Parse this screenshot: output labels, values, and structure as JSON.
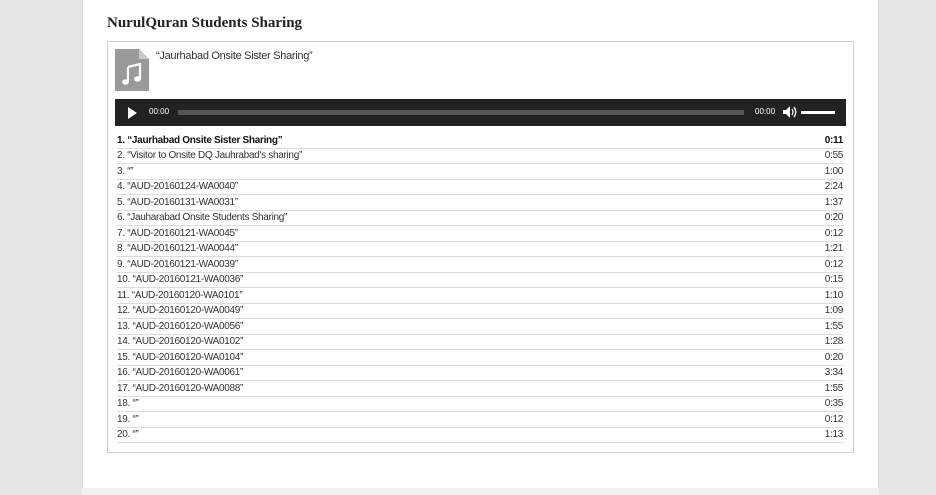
{
  "page": {
    "title": "NurulQuran Students Sharing"
  },
  "player": {
    "current_title": "“Jaurhabad Onsite Sister Sharing”",
    "current_time": "00:00",
    "total_time": "00:00",
    "progress": 0,
    "volume": 1.0,
    "icons": {
      "file": "audio-file-icon",
      "play": "play-icon",
      "volume": "volume-icon"
    }
  },
  "tracks": [
    {
      "title": "1. “Jaurhabad Onsite Sister Sharing”",
      "duration": "0:11",
      "active": true
    },
    {
      "title": "2. “Visitor to Onsite DQ Jauhrabad's sharing”",
      "duration": "0:55"
    },
    {
      "title": "3. “”",
      "duration": "1:00"
    },
    {
      "title": "4. “AUD-20160124-WA0040”",
      "duration": "2:24"
    },
    {
      "title": "5. “AUD-20160131-WA0031”",
      "duration": "1:37"
    },
    {
      "title": "6. “Jauharabad Onsite Students Sharing”",
      "duration": "0:20"
    },
    {
      "title": "7. “AUD-20160121-WA0045”",
      "duration": "0:12"
    },
    {
      "title": "8. “AUD-20160121-WA0044”",
      "duration": "1:21"
    },
    {
      "title": "9. “AUD-20160121-WA0039”",
      "duration": "0:12"
    },
    {
      "title": "10. “AUD-20160121-WA0036”",
      "duration": "0:15"
    },
    {
      "title": "11. “AUD-20160120-WA0101”",
      "duration": "1:10"
    },
    {
      "title": "12. “AUD-20160120-WA0049”",
      "duration": "1:09"
    },
    {
      "title": "13. “AUD-20160120-WA0056”",
      "duration": "1:55"
    },
    {
      "title": "14. “AUD-20160120-WA0102”",
      "duration": "1:28"
    },
    {
      "title": "15. “AUD-20160120-WA0104”",
      "duration": "0:20"
    },
    {
      "title": "16. “AUD-20160120-WA0061”",
      "duration": "3:34"
    },
    {
      "title": "17. “AUD-20160120-WA0088”",
      "duration": "1:55"
    },
    {
      "title": "18. “”",
      "duration": "0:35"
    },
    {
      "title": "19. “”",
      "duration": "0:12"
    },
    {
      "title": "20. “”",
      "duration": "1:13"
    }
  ]
}
